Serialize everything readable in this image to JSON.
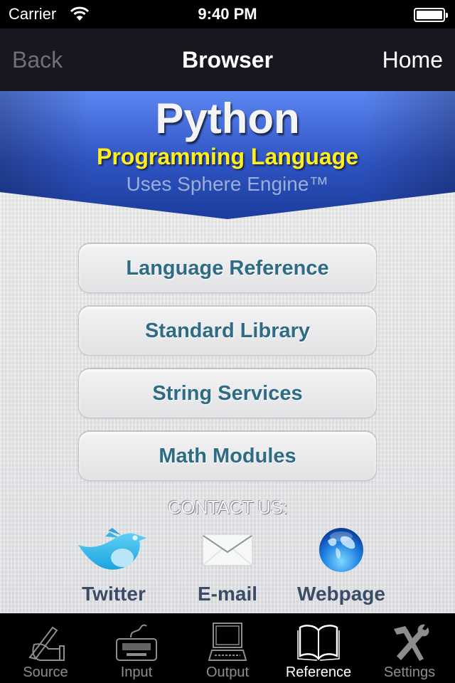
{
  "status_bar": {
    "carrier": "Carrier",
    "time": "9:40 PM",
    "battery_level": 1.0
  },
  "nav_bar": {
    "back_label": "Back",
    "title": "Browser",
    "home_label": "Home"
  },
  "banner": {
    "title": "Python",
    "subtitle": "Programming Language",
    "engine": "Uses Sphere Engine™",
    "colors": {
      "blue_top": "#5c86f2",
      "blue_bottom": "#1b3c9c",
      "subtitle": "#ffee1a"
    }
  },
  "menu": {
    "items": [
      {
        "label": "Language Reference"
      },
      {
        "label": "Standard Library"
      },
      {
        "label": "String Services"
      },
      {
        "label": "Math Modules"
      }
    ],
    "text_color": "#2e6b85"
  },
  "contact": {
    "heading": "CONTACT US:",
    "items": [
      {
        "label": "Twitter",
        "icon": "twitter-bird-icon"
      },
      {
        "label": "E-mail",
        "icon": "envelope-icon"
      },
      {
        "label": "Webpage",
        "icon": "globe-icon"
      }
    ]
  },
  "tab_bar": {
    "tabs": [
      {
        "label": "Source",
        "icon": "hand-writing-icon",
        "active": false
      },
      {
        "label": "Input",
        "icon": "keyboard-icon",
        "active": false
      },
      {
        "label": "Output",
        "icon": "computer-icon",
        "active": false
      },
      {
        "label": "Reference",
        "icon": "open-book-icon",
        "active": true
      },
      {
        "label": "Settings",
        "icon": "hammer-wrench-icon",
        "active": false
      }
    ]
  }
}
